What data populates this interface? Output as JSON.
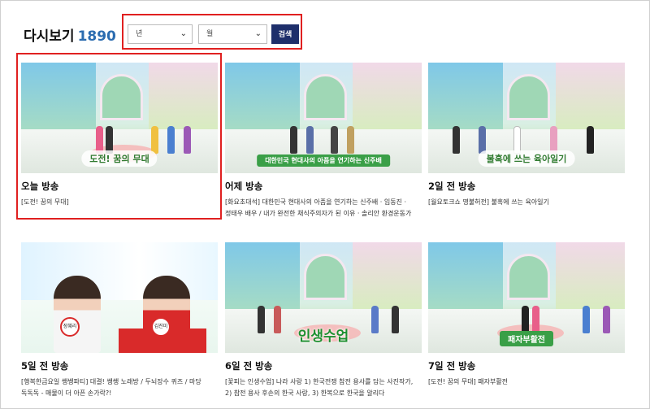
{
  "header": {
    "title": "다시보기",
    "count": "1890"
  },
  "filters": {
    "year_value": "년",
    "month_value": "월",
    "search_label": "검색"
  },
  "colors": {
    "accent_blue": "#2b6cb0",
    "search_button": "#1e2f6b",
    "highlight_red": "#e02020"
  },
  "videos": [
    {
      "title": "오늘 방송",
      "desc": "[도전! 꿈의 무대]",
      "thumb_caption": "도전! 꿈의 무대"
    },
    {
      "title": "어제 방송",
      "desc": "[화요초대석] 대한민국 현대사의 아픔을 연기하는 신주배 · 임동진 · 정태우 배우 / 내가 완전한 채식주의자가 된 이유 · 솔리안 환경운동가",
      "thumb_caption": "대한민국 현대사의 아픔을 연기하는 신주배"
    },
    {
      "title": "2일 전 방송",
      "desc": "[월요토크쇼 명불허전] 불혹에 쓰는 육아일기",
      "thumb_caption": "불혹에 쓰는 육아일기"
    },
    {
      "title": "5일 전 방송",
      "desc": "[행복한금요일 쌩쌩파티] 대결! 쌩쌩 노래방 / 두뇌장수 퀴즈 / 마당 독독독 - 매물이 더 아픈 손가락?!",
      "thumb_caption": ""
    },
    {
      "title": "6일 전 방송",
      "desc": "[꽃피는 인생수업] 나라 사랑 1) 한국전쟁 참전 용사를 담는 사진작가, 2) 참전 용사 후손의 한국 사랑, 3) 한복으로 한국을 알리다",
      "thumb_caption": "인생수업"
    },
    {
      "title": "7일 전 방송",
      "desc": "[도전! 꿈의 무대] 패자부활전",
      "thumb_caption": "패자부활전"
    }
  ],
  "thumb_people": {
    "tag_left": "장혜리",
    "tag_right": "김진미"
  }
}
